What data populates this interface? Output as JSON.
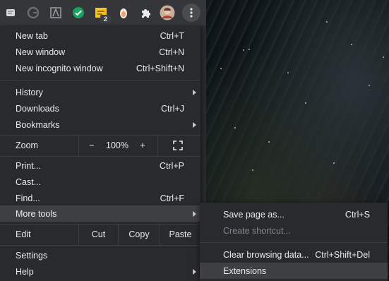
{
  "toolbar": {
    "extensions": [
      {
        "icon": "docs-extension-icon"
      },
      {
        "icon": "grammar-extension-icon"
      },
      {
        "icon": "pdf-extension-icon"
      },
      {
        "icon": "checkmark-extension-icon",
        "color": "#1aa260"
      },
      {
        "icon": "sticky-note-extension-icon",
        "color": "#f9c21f",
        "badge": "2"
      },
      {
        "icon": "egg-extension-icon",
        "color": "#f0a070"
      },
      {
        "icon": "puzzle-icon"
      },
      {
        "icon": "profile-avatar"
      },
      {
        "icon": "more-vertical-icon"
      }
    ],
    "badge_count": "2"
  },
  "menu": {
    "new_tab": {
      "label": "New tab",
      "shortcut": "Ctrl+T"
    },
    "new_window": {
      "label": "New window",
      "shortcut": "Ctrl+N"
    },
    "new_incognito": {
      "label": "New incognito window",
      "shortcut": "Ctrl+Shift+N"
    },
    "history": {
      "label": "History"
    },
    "downloads": {
      "label": "Downloads",
      "shortcut": "Ctrl+J"
    },
    "bookmarks": {
      "label": "Bookmarks"
    },
    "zoom": {
      "label": "Zoom",
      "minus": "−",
      "value": "100%",
      "plus": "+"
    },
    "print": {
      "label": "Print...",
      "shortcut": "Ctrl+P"
    },
    "cast": {
      "label": "Cast..."
    },
    "find": {
      "label": "Find...",
      "shortcut": "Ctrl+F"
    },
    "more_tools": {
      "label": "More tools"
    },
    "edit": {
      "label": "Edit",
      "cut": "Cut",
      "copy": "Copy",
      "paste": "Paste"
    },
    "settings": {
      "label": "Settings"
    },
    "help": {
      "label": "Help"
    }
  },
  "submenu": {
    "save_page": {
      "label": "Save page as...",
      "shortcut": "Ctrl+S"
    },
    "create_shortcut": {
      "label": "Create shortcut..."
    },
    "clear_data": {
      "label": "Clear browsing data...",
      "shortcut": "Ctrl+Shift+Del"
    },
    "extensions": {
      "label": "Extensions"
    }
  }
}
